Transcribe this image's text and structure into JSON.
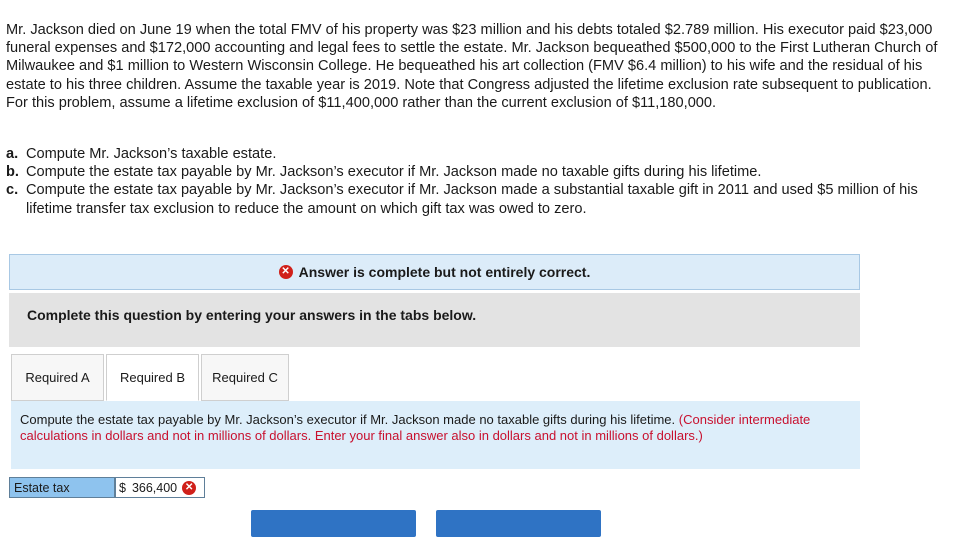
{
  "problem": {
    "text": "Mr. Jackson died on June 19 when the total FMV of his property was $23 million and his debts totaled $2.789 million. His executor paid $23,000 funeral expenses and $172,000 accounting and legal fees to settle the estate. Mr. Jackson bequeathed $500,000 to the First Lutheran Church of Milwaukee and $1 million to Western Wisconsin College. He bequeathed his art collection (FMV $6.4 million) to his wife and the residual of his estate to his three children. Assume the taxable year is 2019. Note that Congress adjusted the lifetime exclusion rate subsequent to publication. For this problem, assume a lifetime exclusion of $11,400,000 rather than the current exclusion of $11,180,000."
  },
  "parts": [
    {
      "label": "a.",
      "text": "Compute Mr. Jackson’s taxable estate."
    },
    {
      "label": "b.",
      "text": "Compute the estate tax payable by Mr. Jackson’s executor if Mr. Jackson made no taxable gifts during his lifetime."
    },
    {
      "label": "c.",
      "text": "Compute the estate tax payable by Mr. Jackson’s executor if Mr. Jackson made a substantial taxable gift in 2011 and used $5 million of his lifetime transfer tax exclusion to reduce the amount on which gift tax was owed to zero."
    }
  ],
  "banner": {
    "icon": "x-circle-icon",
    "text": "Answer is complete but not entirely correct."
  },
  "instructions": "Complete this question by entering your answers in the tabs below.",
  "tabs": [
    {
      "label": "Required A",
      "active": false
    },
    {
      "label": "Required B",
      "active": true
    },
    {
      "label": "Required C",
      "active": false
    }
  ],
  "question": {
    "text": "Compute the estate tax payable by Mr. Jackson’s executor if Mr. Jackson made no taxable gifts during his lifetime.",
    "note": "(Consider intermediate calculations in dollars and not in millions of dollars. Enter your final answer also in dollars and not in millions of dollars.)"
  },
  "answer": {
    "label": "Estate tax",
    "currency": "$",
    "value": "366,400",
    "status": "incorrect"
  },
  "colors": {
    "banner_bg": "#dcecf9",
    "instructions_bg": "#e3e3e3",
    "question_bg": "#ddeefa",
    "note_red": "#c8102e",
    "error_red": "#d0201a",
    "label_blue": "#8ec3ee",
    "button_blue": "#2f73c4"
  }
}
